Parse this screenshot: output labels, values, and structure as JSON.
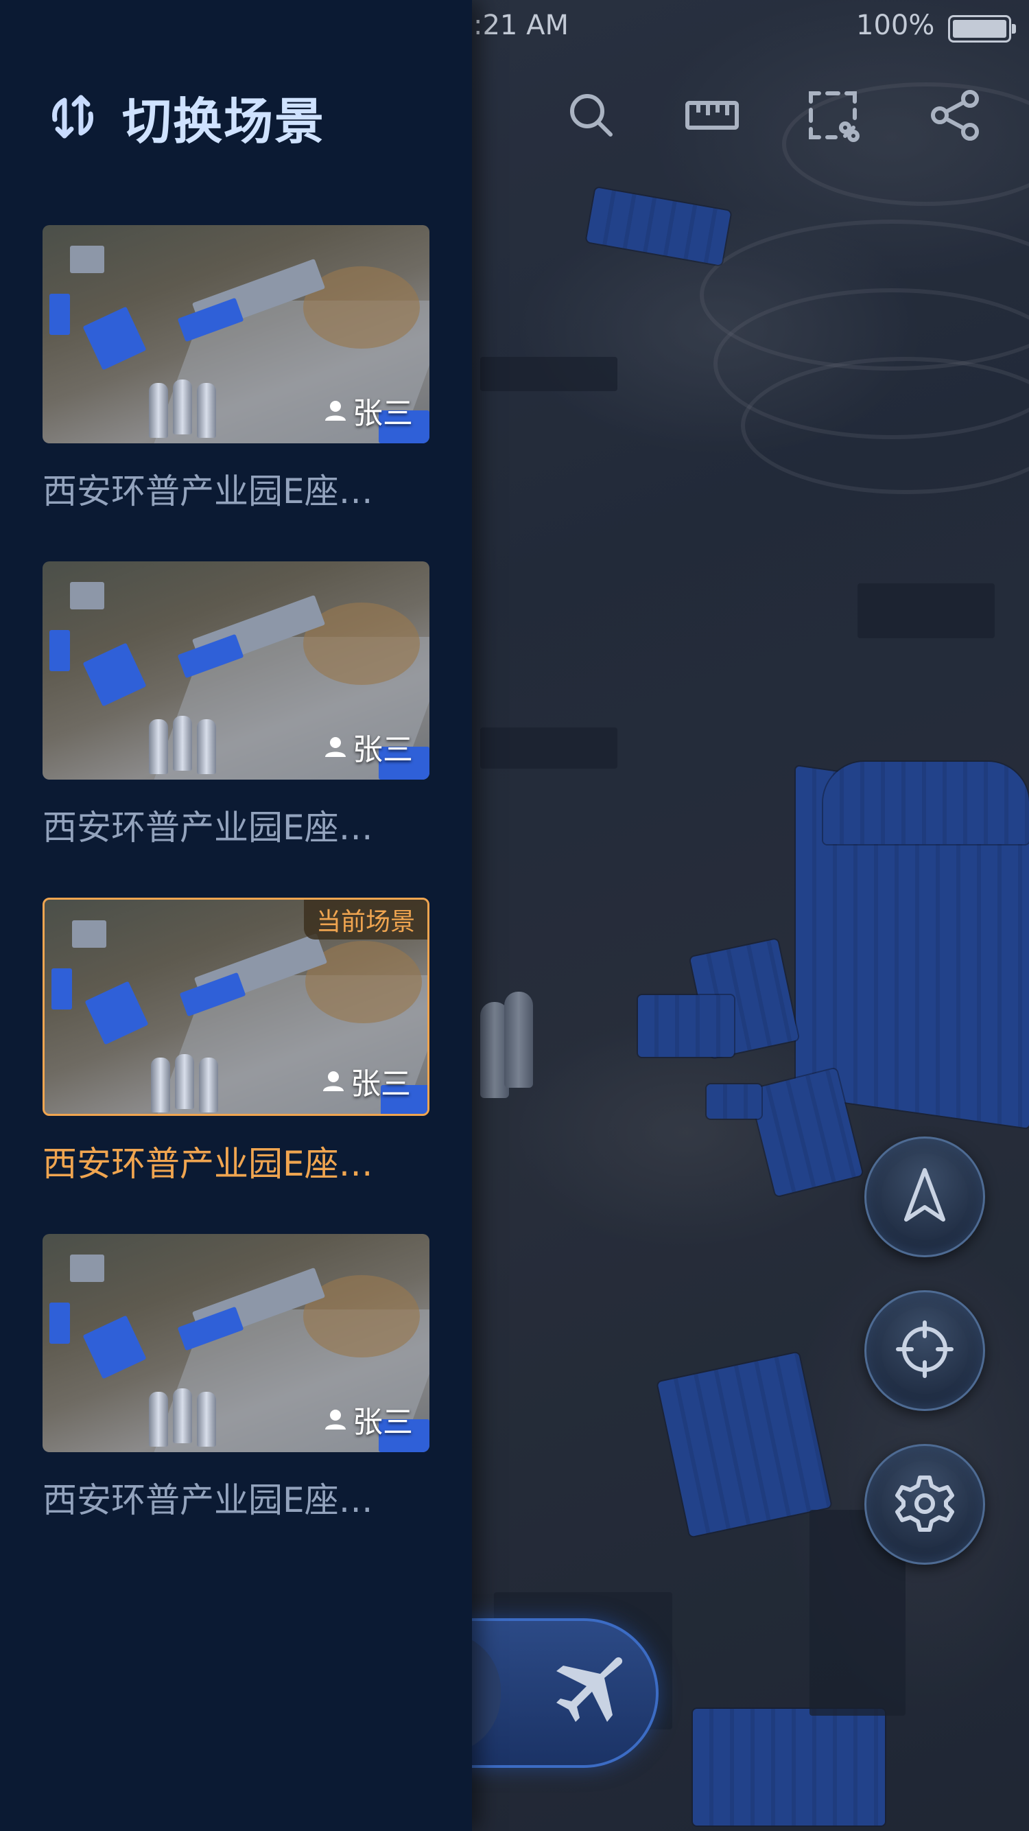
{
  "status_bar": {
    "time": ":21 AM",
    "battery_percent": "100%"
  },
  "toolbar": {
    "icons": [
      "search-icon",
      "ruler-icon",
      "select-area-icon",
      "share-icon"
    ]
  },
  "drawer": {
    "title": "切换场景",
    "icon": "switch-icon",
    "current_badge": "当前场景",
    "scenes": [
      {
        "name": "西安环普产业园E座…",
        "owner": "张三",
        "current": false
      },
      {
        "name": "西安环普产业园E座…",
        "owner": "张三",
        "current": false
      },
      {
        "name": "西安环普产业园E座…",
        "owner": "张三",
        "current": true
      },
      {
        "name": "西安环普产业园E座…",
        "owner": "张三",
        "current": false
      }
    ]
  },
  "map_controls": {
    "icons": [
      "compass-icon",
      "locate-icon",
      "settings-icon"
    ]
  },
  "bottom_bar": {
    "icons": [
      "plane-icon"
    ]
  },
  "colors": {
    "drawer_bg": "#0b1a33",
    "accent_current": "#f0a550",
    "title": "#cfe2ff"
  }
}
